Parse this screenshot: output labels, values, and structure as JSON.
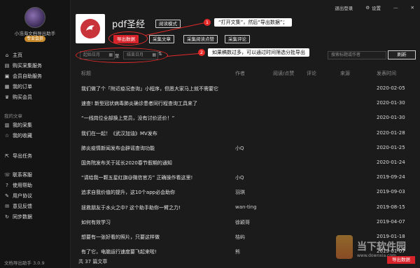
{
  "sidebar": {
    "user_name": "小浩海文档导出助手",
    "badge": "专业会员",
    "items": [
      {
        "label": "主页",
        "icon": "home-icon",
        "glyph": "⌂"
      },
      {
        "label": "购买采集服务",
        "icon": "cart-icon",
        "glyph": "▤"
      },
      {
        "label": "会员自助服务",
        "icon": "service-icon",
        "glyph": "▣"
      },
      {
        "label": "我的订单",
        "icon": "order-icon",
        "glyph": "▦"
      },
      {
        "label": "购买会员",
        "icon": "member-icon",
        "glyph": "♛"
      }
    ],
    "section_docs": "我的文章",
    "doc_items": [
      {
        "label": "我的采集",
        "icon": "collect-icon",
        "glyph": "▥"
      },
      {
        "label": "我的收藏",
        "icon": "star-icon",
        "glyph": "☆"
      }
    ],
    "export_task": {
      "label": "导出任务",
      "icon": "export-icon",
      "glyph": "⇱"
    },
    "help_items": [
      {
        "label": "联系客服",
        "icon": "headset-icon",
        "glyph": "☏"
      },
      {
        "label": "使用帮助",
        "icon": "help-icon",
        "glyph": "?"
      },
      {
        "label": "用户协议",
        "icon": "agreement-icon",
        "glyph": "✎"
      },
      {
        "label": "意见反馈",
        "icon": "feedback-icon",
        "glyph": "✉"
      },
      {
        "label": "同步数据",
        "icon": "sync-icon",
        "glyph": "↻"
      }
    ],
    "version": "文档导出助手 3.0.9"
  },
  "top": {
    "logout": "退出登录",
    "settings": "设置"
  },
  "account": {
    "name": "pdf圣经",
    "read_mode": "阅读模式",
    "export_data": "导出数据",
    "collect_articles": "采集文章",
    "collect_read_like": "采集阅读点赞",
    "collect_comments": "采集评论"
  },
  "callouts": {
    "one_num": "1",
    "one_text": "“打开文集”，然后“导出数据”；",
    "two_num": "2",
    "two_text": "如果稿数过多，可以通过时间筛选分批导出"
  },
  "filters": {
    "start_placeholder": "起始日月",
    "separator": "至",
    "end_placeholder": "结束日月",
    "search_placeholder": "搜索标题或作者",
    "refresh": "刷新"
  },
  "table": {
    "headers": [
      "标题",
      "作者",
      "阅读/点赞",
      "评论",
      "来源",
      "发表时间"
    ],
    "rows": [
      {
        "title": "我们做了个「附近疫况查询」小程序，但愿大家马上就不需要它",
        "author": "",
        "date": "2020-02-05"
      },
      {
        "title": "速查! 新型冠状病毒肺炎确诊患者同行程查询工具来了",
        "author": "",
        "date": "2020-01-30"
      },
      {
        "title": "“一线岗位全部换上党员，没有讨价还价！”",
        "author": "",
        "date": "2020-01-30"
      },
      {
        "title": "我们在一起！《武汉加油》MV发布",
        "author": "",
        "date": "2020-01-28"
      },
      {
        "title": "肺炎疫情新闻发布会辟谣查询功能",
        "author": "小Q",
        "date": "2020-01-25"
      },
      {
        "title": "国务院发布关于延长2020春节假期的通知",
        "author": "",
        "date": "2020-01-24"
      },
      {
        "title": "“请给我一颗五星红旗@微信官方” 正确操作看这里!",
        "author": "小Q",
        "date": "2019-09-24"
      },
      {
        "title": "追求自我价值的提升，这10个app必会助你",
        "author": "羽琪",
        "date": "2019-09-03"
      },
      {
        "title": "拯救朋友于水火之中? 这个助手助你一臂之力!",
        "author": "wan-ting",
        "date": "2019-08-15"
      },
      {
        "title": "如何有效学习",
        "author": "徐颖哥",
        "date": "2019-04-07"
      },
      {
        "title": "想要有一张好看的照片，只要这样做",
        "author": "桔屿",
        "date": "2019-01-18"
      },
      {
        "title": "有了它，电脑运行速度要飞起来啦!",
        "author": "熊",
        "date": "2019-01-07"
      }
    ]
  },
  "footer": {
    "count": "共 37 篇文章",
    "export": "导出数据"
  },
  "watermark": {
    "title": "当下软件园",
    "sub": "www.downxia.com"
  },
  "colors": {
    "accent_red": "#d9232a",
    "callout_red": "#e52a2a",
    "background": "#1b1b1b"
  }
}
